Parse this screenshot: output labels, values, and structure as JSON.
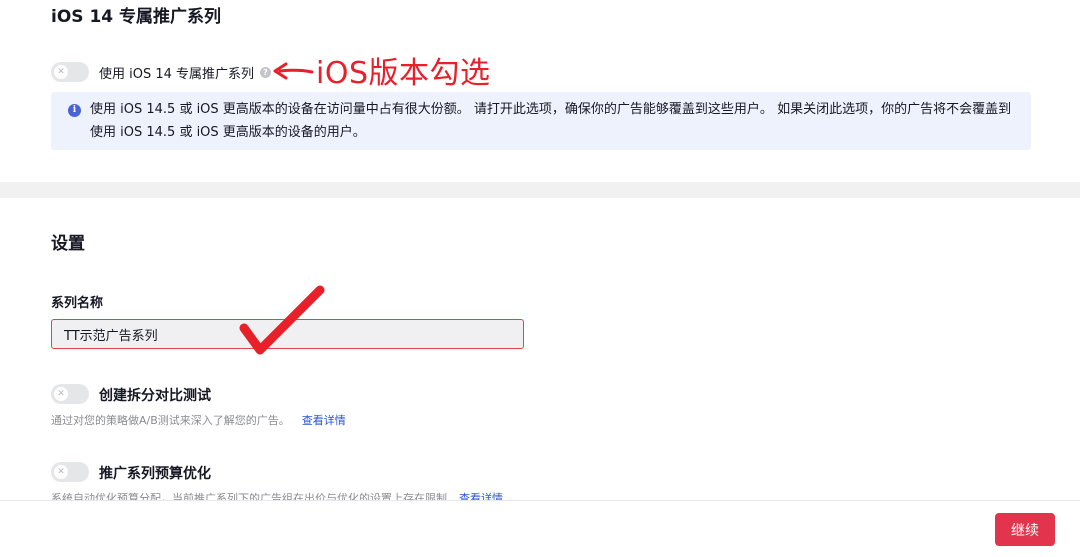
{
  "ios_section": {
    "title": "iOS 14 专属推广系列",
    "toggle_label": "使用 iOS 14 专属推广系列",
    "info_text": "使用 iOS 14.5 或 iOS 更高版本的设备在访问量中占有很大份额。 请打开此选项，确保你的广告能够覆盖到这些用户。 如果关闭此选项，你的广告将不会覆盖到使用 iOS 14.5 或 iOS 更高版本的设备的用户。",
    "toggle_on": false
  },
  "annotation": {
    "text": "iOS版本勾选",
    "color": "#e8202a"
  },
  "settings": {
    "title": "设置",
    "name_label": "系列名称",
    "name_value": "TT示范广告系列",
    "split_test": {
      "label": "创建拆分对比测试",
      "desc": "通过对您的策略做A/B测试来深入了解您的广告。",
      "link": "查看详情",
      "toggle_on": false
    },
    "budget_opt": {
      "label": "推广系列预算优化",
      "desc": "系统自动优化预算分配，当前推广系列下的广告组在出价与优化的设置上存在限制",
      "link": "查看详情",
      "toggle_on": false
    }
  },
  "footer": {
    "continue_label": "继续"
  },
  "colors": {
    "accent": "#e2344c",
    "link": "#2a50e0",
    "info_bg": "#eef2fc",
    "info_icon": "#4a64d6"
  }
}
